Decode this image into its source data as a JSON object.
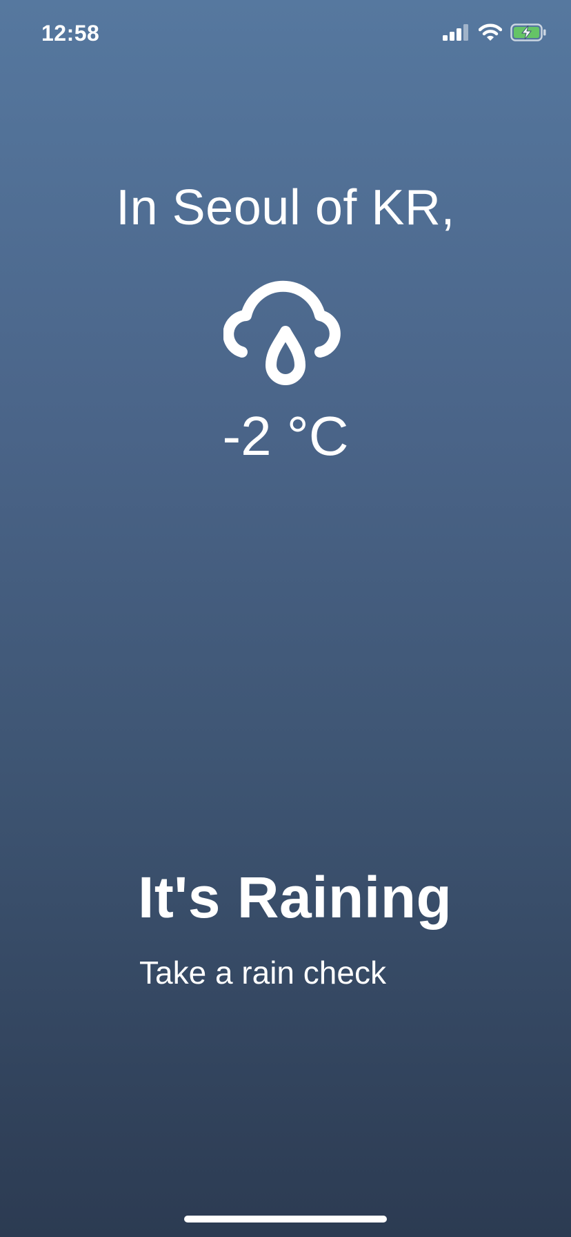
{
  "status_bar": {
    "time": "12:58",
    "icons": [
      "cellular-signal-icon",
      "wifi-icon",
      "battery-charging-icon"
    ],
    "battery_color": "#65c466"
  },
  "weather": {
    "location": "In Seoul of KR,",
    "icon": "rain-cloud-icon",
    "temperature": "-2 °C",
    "headline": "It's Raining",
    "subtitle": "Take a rain check"
  },
  "colors": {
    "gradient_top": "#56789f",
    "gradient_bottom": "#2c3b52",
    "text": "#ffffff"
  }
}
